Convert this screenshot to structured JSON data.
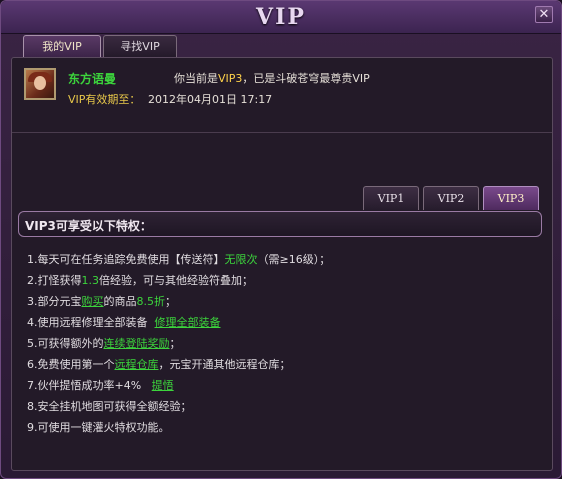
{
  "window": {
    "title": "VIP",
    "close_icon_glyph": "✕"
  },
  "tabs": [
    {
      "label": "我的VIP",
      "active": true
    },
    {
      "label": "寻找VIP",
      "active": false
    }
  ],
  "user": {
    "name": "东方语曼",
    "notice_prefix": "你当前是",
    "notice_level": "VIP3",
    "notice_suffix": "，已是斗破苍穹最尊贵VIP",
    "expiry_label": "VIP有效期至：",
    "expiry_value": "2012年04月01日 17:17"
  },
  "vip_tabs": [
    {
      "label": "VIP1",
      "active": false
    },
    {
      "label": "VIP2",
      "active": false
    },
    {
      "label": "VIP3",
      "active": true
    }
  ],
  "privileges": {
    "title": "VIP3可享受以下特权：",
    "items": [
      {
        "a": "1.每天可在任务追踪免费使用【传送符】",
        "b": "无限次",
        "c": "（需≥16级）；"
      },
      {
        "a": "2.打怪获得",
        "b": "1.3",
        "c": "倍经验，可与其他经验符叠加；"
      },
      {
        "a": "3.部分元宝",
        "link": "购买",
        "c": "的商品",
        "d": "8.5折",
        "e": "；"
      },
      {
        "a": "4.使用远程修理全部装备",
        "link": "修理全部装备"
      },
      {
        "a": "5.可获得额外的",
        "link": "连续登陆奖励",
        "c": "；"
      },
      {
        "a": "6.免费使用第一个",
        "link": "远程仓库",
        "c": "，元宝开通其他远程仓库；"
      },
      {
        "a": "7.伙伴提悟成功率+4%",
        "link": "提悟"
      },
      {
        "a": "8.安全挂机地图可获得全额经验；"
      },
      {
        "a": "9.可使用一键灌火特权功能。"
      }
    ]
  },
  "colors": {
    "accent_green": "#3cd43c",
    "vip_gold": "#ffd24a",
    "expiry_gold": "#e8c84a",
    "active_tab": "#7a4a8c",
    "background": "#2a1a34"
  }
}
